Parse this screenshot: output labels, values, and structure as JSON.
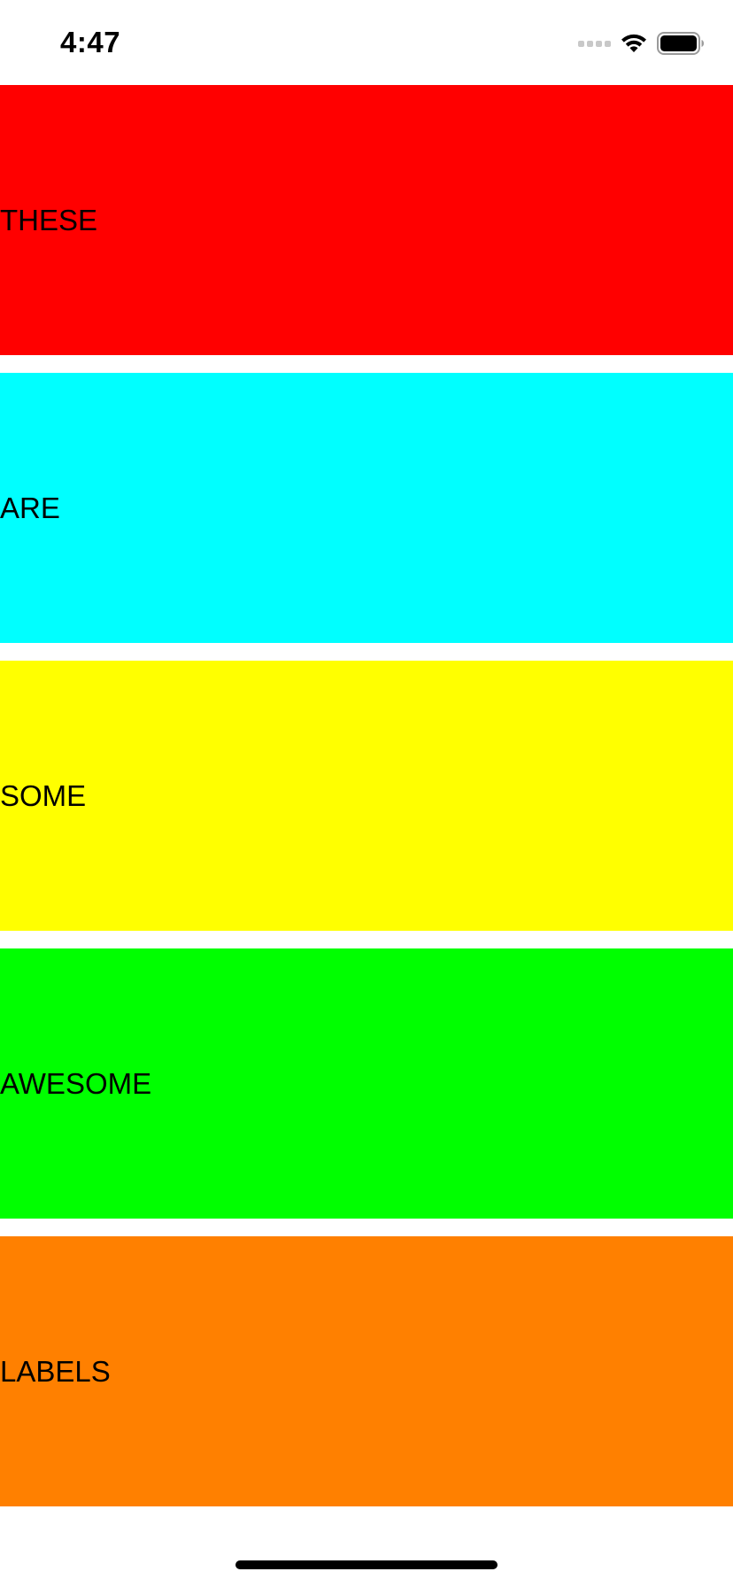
{
  "status_bar": {
    "time": "4:47",
    "icons": [
      "cellular-signal-icon",
      "wifi-icon",
      "battery-icon"
    ]
  },
  "labels": [
    {
      "text": "THESE",
      "color": "#ff0000"
    },
    {
      "text": "ARE",
      "color": "#00ffff"
    },
    {
      "text": "SOME",
      "color": "#ffff00"
    },
    {
      "text": "AWESOME",
      "color": "#00ff00"
    },
    {
      "text": "LABELS",
      "color": "#ff8000"
    }
  ]
}
